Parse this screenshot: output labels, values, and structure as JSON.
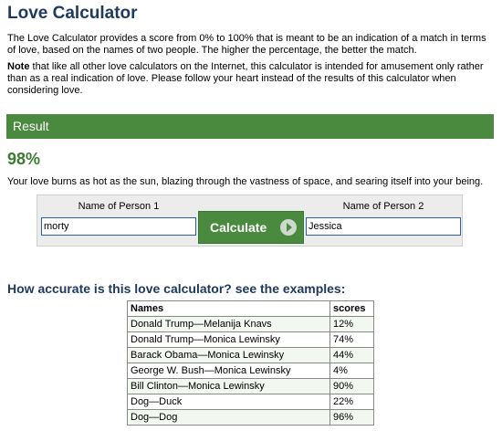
{
  "page": {
    "title": "Love Calculator",
    "intro": "The Love Calculator provides a score from 0% to 100% that is meant to be an indication of a match in terms of love, based on the names of two people. The higher the percentage, the better the match.",
    "note_label": "Note",
    "note_text": " that like all other love calculators on the Internet, this calculator is intended for amusement only rather than as a real indication of love. Please follow your heart instead of the results of this calculator when considering love."
  },
  "result": {
    "header": "Result",
    "score": "98%",
    "message": "Your love burns as hot as the sun, blazing through the vastness of space, and searing itself into your being."
  },
  "calculator": {
    "person1_label": "Name of Person 1",
    "person2_label": "Name of Person 2",
    "person1_value": "morty",
    "person2_value": "Jessica",
    "button_label": "Calculate",
    "button_icon": "arrow-right-circle-icon"
  },
  "examples": {
    "heading": "How accurate is this love calculator? see the examples:",
    "columns": [
      "Names",
      "scores"
    ],
    "rows": [
      [
        "Donald Trump—Melanija Knavs",
        "12%"
      ],
      [
        "Donald Trump—Monica Lewinsky",
        "74%"
      ],
      [
        "Barack Obama—Monica Lewinsky",
        "44%"
      ],
      [
        "George W. Bush—Monica Lewinsky",
        "4%"
      ],
      [
        "Bill Clinton—Monica Lewinsky",
        "90%"
      ],
      [
        "Dog—Duck",
        "22%"
      ],
      [
        "Dog—Dog",
        "96%"
      ]
    ]
  },
  "colors": {
    "heading_navy": "#1f3a60",
    "accent_green": "#4a8a3e",
    "score_green": "#3d7a31",
    "input_border_blue": "#2a5ea8"
  }
}
